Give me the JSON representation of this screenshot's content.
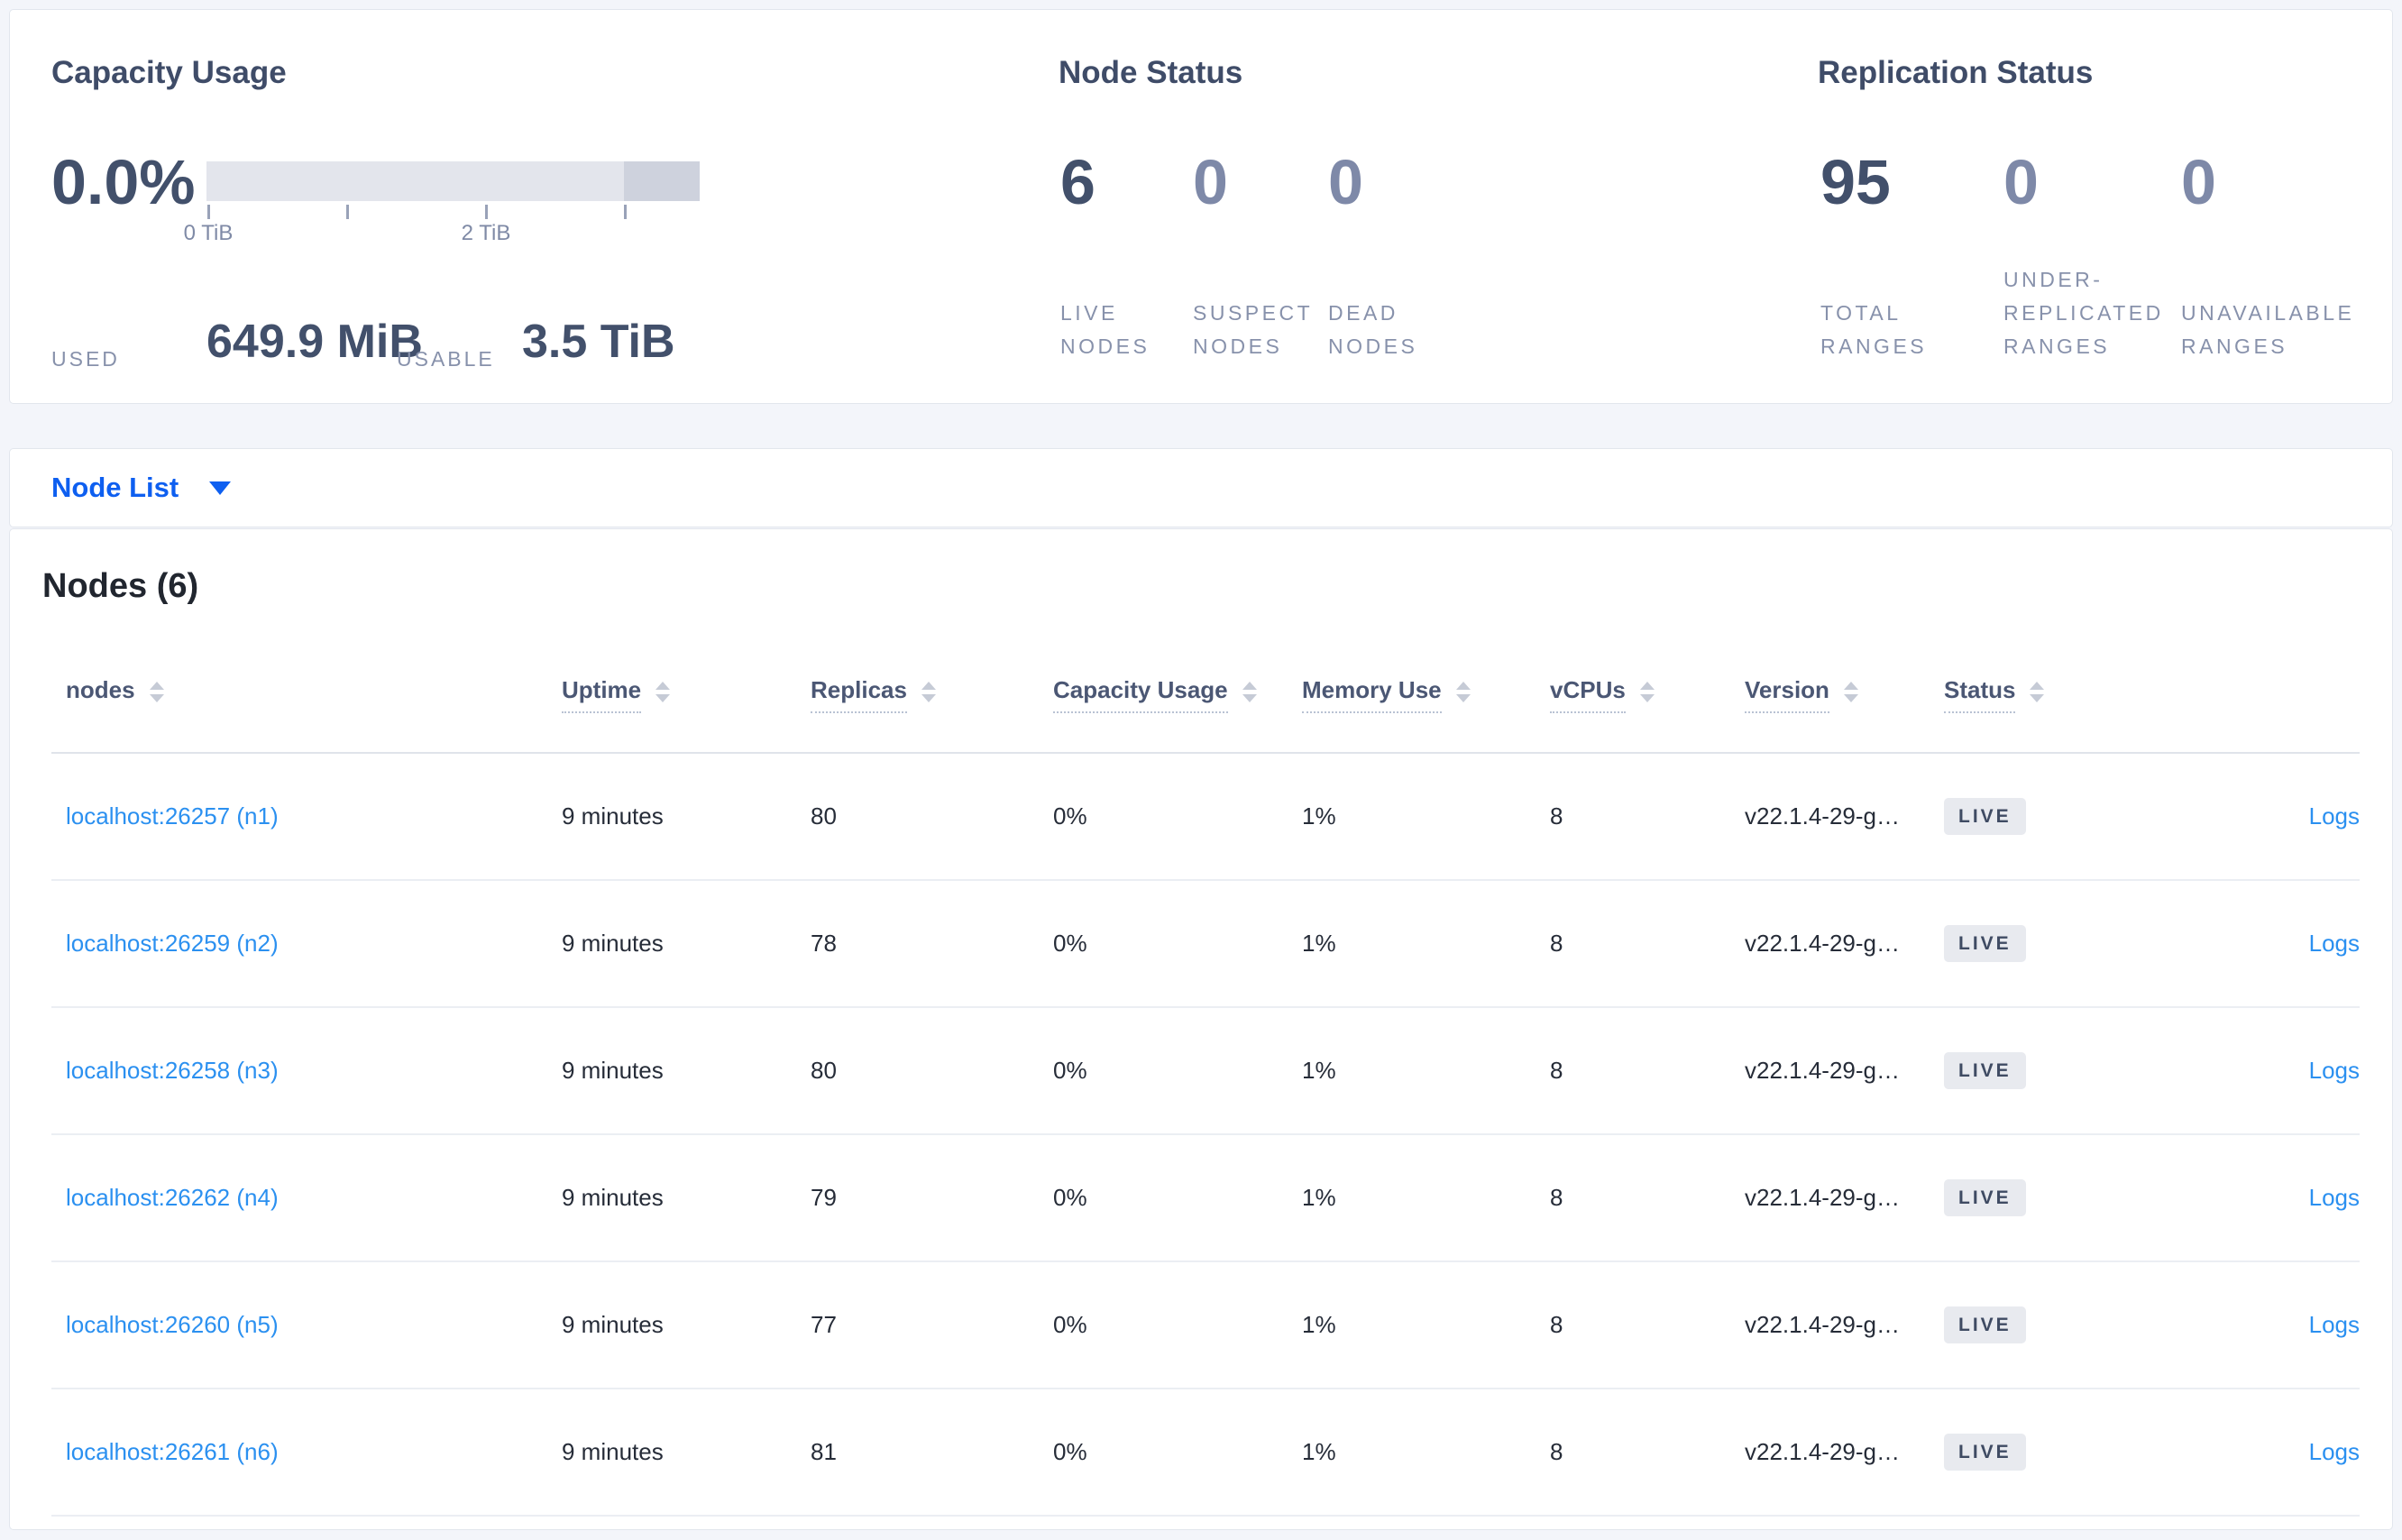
{
  "summary": {
    "capacity": {
      "title": "Capacity Usage",
      "percent": "0.0%",
      "tick_labels": [
        "0 TiB",
        "2 TiB"
      ],
      "used_label": "USED",
      "used_value": "649.9 MiB",
      "usable_label": "USABLE",
      "usable_value": "3.5 TiB"
    },
    "node_status": {
      "title": "Node Status",
      "metrics": [
        {
          "value": "6",
          "label": "LIVE\nNODES"
        },
        {
          "value": "0",
          "label": "SUSPECT\nNODES"
        },
        {
          "value": "0",
          "label": "DEAD\nNODES"
        }
      ]
    },
    "replication": {
      "title": "Replication Status",
      "metrics": [
        {
          "value": "95",
          "label": "TOTAL\nRANGES"
        },
        {
          "value": "0",
          "label": "UNDER-\nREPLICATED\nRANGES"
        },
        {
          "value": "0",
          "label": "UNAVAILABLE\nRANGES"
        }
      ]
    }
  },
  "view_selector": {
    "label": "Node List"
  },
  "nodes_section": {
    "title": "Nodes (6)",
    "logs_label": "Logs",
    "columns": [
      {
        "label": "nodes"
      },
      {
        "label": "Uptime"
      },
      {
        "label": "Replicas"
      },
      {
        "label": "Capacity Usage"
      },
      {
        "label": "Memory Use"
      },
      {
        "label": "vCPUs"
      },
      {
        "label": "Version"
      },
      {
        "label": "Status"
      }
    ],
    "rows": [
      {
        "node": "localhost:26257 (n1)",
        "uptime": "9 minutes",
        "replicas": "80",
        "capacity_usage": "0%",
        "memory_use": "1%",
        "vcpus": "8",
        "version": "v22.1.4-29-g…",
        "status": "LIVE"
      },
      {
        "node": "localhost:26259 (n2)",
        "uptime": "9 minutes",
        "replicas": "78",
        "capacity_usage": "0%",
        "memory_use": "1%",
        "vcpus": "8",
        "version": "v22.1.4-29-g…",
        "status": "LIVE"
      },
      {
        "node": "localhost:26258 (n3)",
        "uptime": "9 minutes",
        "replicas": "80",
        "capacity_usage": "0%",
        "memory_use": "1%",
        "vcpus": "8",
        "version": "v22.1.4-29-g…",
        "status": "LIVE"
      },
      {
        "node": "localhost:26262 (n4)",
        "uptime": "9 minutes",
        "replicas": "79",
        "capacity_usage": "0%",
        "memory_use": "1%",
        "vcpus": "8",
        "version": "v22.1.4-29-g…",
        "status": "LIVE"
      },
      {
        "node": "localhost:26260 (n5)",
        "uptime": "9 minutes",
        "replicas": "77",
        "capacity_usage": "0%",
        "memory_use": "1%",
        "vcpus": "8",
        "version": "v22.1.4-29-g…",
        "status": "LIVE"
      },
      {
        "node": "localhost:26261 (n6)",
        "uptime": "9 minutes",
        "replicas": "81",
        "capacity_usage": "0%",
        "memory_use": "1%",
        "vcpus": "8",
        "version": "v22.1.4-29-g…",
        "status": "LIVE"
      }
    ]
  },
  "colors": {
    "accent_blue": "#0e5ff0",
    "link_blue": "#2b90f0",
    "badge_bg": "#e8eaef",
    "badge_text": "#3f4b63",
    "dark_slate": "#42506b",
    "muted_slate": "#7e89a8",
    "label_gray": "#8791ab",
    "bar_light": "#e3e5ec",
    "bar_dark": "#ced2dd",
    "page_bg": "#f3f5fa"
  }
}
